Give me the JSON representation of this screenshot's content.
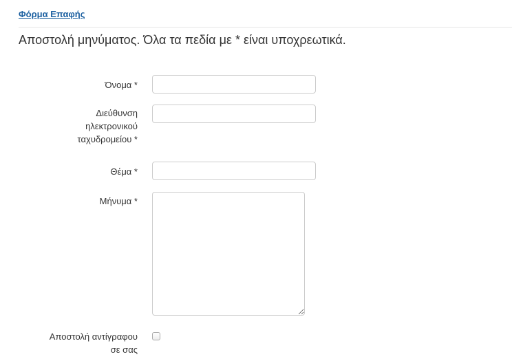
{
  "header": {
    "title": "Φόρμα Επαφής"
  },
  "intro_text": "Αποστολή μηνύματος. Όλα τα πεδία με * είναι υποχρεωτικά.",
  "form": {
    "name": {
      "label": "Όνομα *",
      "value": ""
    },
    "email": {
      "label_lines": [
        "Διεύθυνση",
        "ηλεκτρονικού",
        "ταχυδρομείου *"
      ],
      "value": ""
    },
    "subject": {
      "label": "Θέμα *",
      "value": ""
    },
    "message": {
      "label": "Μήνυμα *",
      "value": ""
    },
    "copy": {
      "label_lines": [
        "Αποστολή αντίγραφου",
        "σε σας"
      ],
      "checked": false
    }
  },
  "colors": {
    "link": "#1a5fa0",
    "text": "#333333",
    "border": "#cccccc"
  }
}
